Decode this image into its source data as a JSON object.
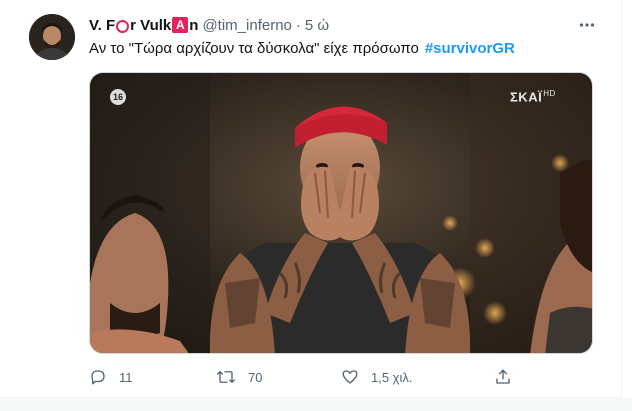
{
  "tweet": {
    "display_name_parts": [
      "V. F",
      "r Vulk",
      "n"
    ],
    "display_name_emoji_letter": "A",
    "handle": "@tim_inferno",
    "dot": "·",
    "time": "5 ώ",
    "text": "Αν το \"Τώρα αρχίζουν τα δύσκολα\" είχε πρόσωπο",
    "hashtag": "#survivorGR"
  },
  "media": {
    "age_rating": "16",
    "channel_logo": "ΣΚΑΪ",
    "channel_suffix": "HD"
  },
  "actions": {
    "reply_count": "11",
    "retweet_count": "70",
    "like_count": "1,5 χιλ.",
    "share_count": ""
  },
  "icons": {
    "more": "more-horizontal-icon",
    "reply": "reply-icon",
    "retweet": "retweet-icon",
    "like": "like-icon",
    "share": "share-icon"
  },
  "colors": {
    "text": "#0f1419",
    "secondary": "#536471",
    "hashtag": "#1d9bf0",
    "emoji_red": "#e0245e",
    "bandana": "#d6283a"
  }
}
